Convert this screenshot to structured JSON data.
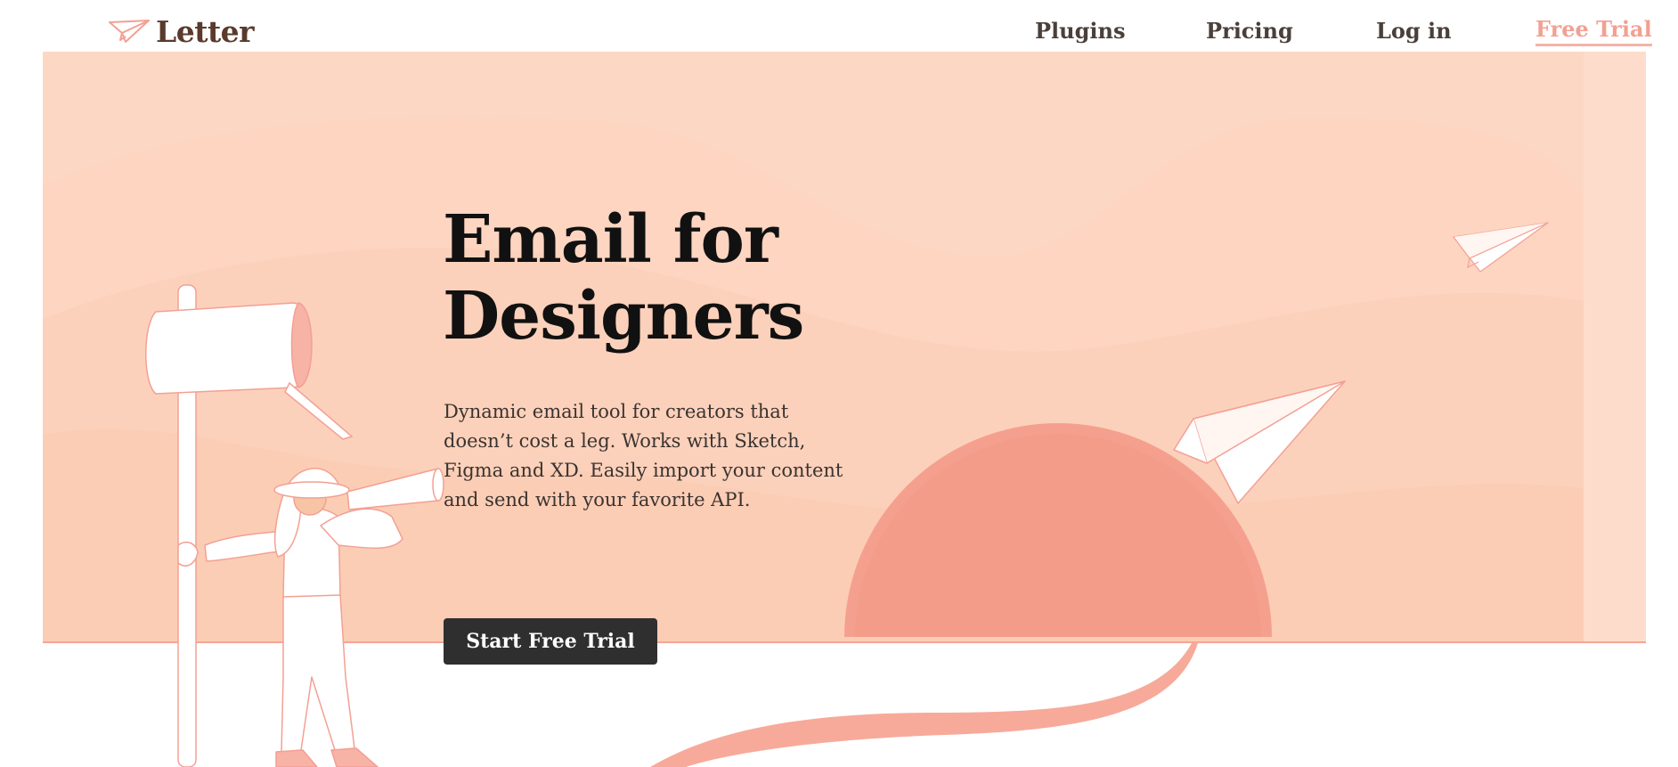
{
  "header": {
    "logo_text": "Letter",
    "logo_icon": "paper-plane-icon",
    "nav": {
      "plugins": "Plugins",
      "pricing": "Pricing",
      "login": "Log in",
      "free_trial": "Free Trial"
    }
  },
  "hero": {
    "title_line1": "Email for",
    "title_line2": "Designers",
    "description": "Dynamic email tool for creators that doesn’t cost a leg. Works with Sketch, Figma and XD. Easily import your content and send with your favorite API.",
    "cta_label": "Start Free Trial"
  },
  "colors": {
    "hero_bg": "#fcd8c4",
    "accent": "#f3a093",
    "sun": "#f5a08e",
    "button": "#2f2f2f",
    "logo": "#5a3a2c"
  }
}
